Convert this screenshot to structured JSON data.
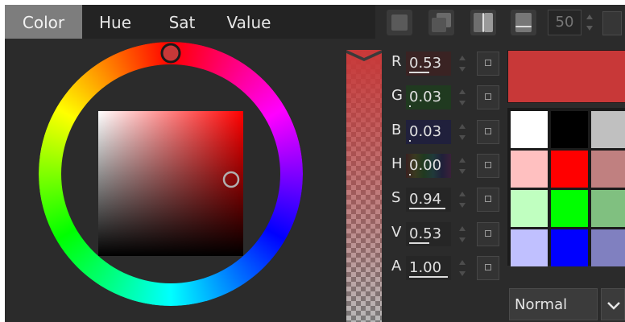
{
  "tabs": [
    {
      "label": "Color",
      "active": true
    },
    {
      "label": "Hue",
      "active": false
    },
    {
      "label": "Sat",
      "active": false
    },
    {
      "label": "Value",
      "active": false
    }
  ],
  "toolbar": {
    "number_value": "50",
    "icons": [
      "mode-solid-icon",
      "mode-layered-icon",
      "mode-split-icon",
      "mode-gradient-icon"
    ]
  },
  "picker": {
    "hue_degrees": 0,
    "saturation": 0.94,
    "value": 0.53
  },
  "channels": [
    {
      "label": "R",
      "value": "0.53",
      "level": 0.53,
      "tint": "#3a2323"
    },
    {
      "label": "G",
      "value": "0.03",
      "level": 0.03,
      "tint": "#203a20"
    },
    {
      "label": "B",
      "value": "0.03",
      "level": 0.03,
      "tint": "#20203c"
    },
    {
      "label": "H",
      "value": "0.00",
      "level": 0.0,
      "tint": "rainbow"
    },
    {
      "label": "S",
      "value": "0.94",
      "level": 0.94,
      "tint": "#262626"
    },
    {
      "label": "V",
      "value": "0.53",
      "level": 0.53,
      "tint": "#262626"
    },
    {
      "label": "A",
      "value": "1.00",
      "level": 1.0,
      "tint": "#262626"
    }
  ],
  "current_color": "#c83838",
  "swatches": [
    [
      "#ffffff",
      "#000000",
      "#c0c0c0"
    ],
    [
      "#ffc0c0",
      "#ff0000",
      "#c08080"
    ],
    [
      "#c0ffc0",
      "#00ff00",
      "#80c080"
    ],
    [
      "#c0c0ff",
      "#0000ff",
      "#8080c0"
    ]
  ],
  "blend_mode": "Normal"
}
